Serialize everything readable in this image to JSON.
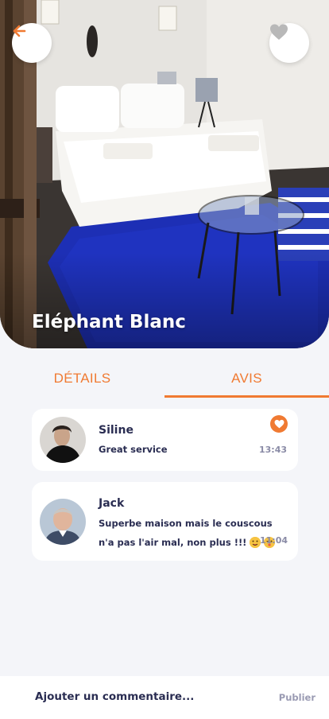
{
  "hero": {
    "title": "Eléphant Blanc",
    "back_icon": "arrow-left-icon",
    "favorite_icon": "heart-icon"
  },
  "tabs": [
    {
      "label": "DÉTAILS",
      "active": false
    },
    {
      "label": "AVIS",
      "active": true
    }
  ],
  "reviews": [
    {
      "name": "Siline",
      "text": "Great service",
      "time": "13:43",
      "liked": true
    },
    {
      "name": "Jack",
      "text_line1": "Superbe maison mais le couscous",
      "text_line2": "n'a pas l'air mal, non plus !!!",
      "time": "11:04",
      "liked": false
    }
  ],
  "comment": {
    "placeholder": "Ajouter un commentaire...",
    "publish_label": "Publier"
  },
  "colors": {
    "accent": "#f07a32",
    "text_dark": "#2a2d52",
    "text_muted": "#8a8ba6",
    "background": "#f4f5f9"
  }
}
